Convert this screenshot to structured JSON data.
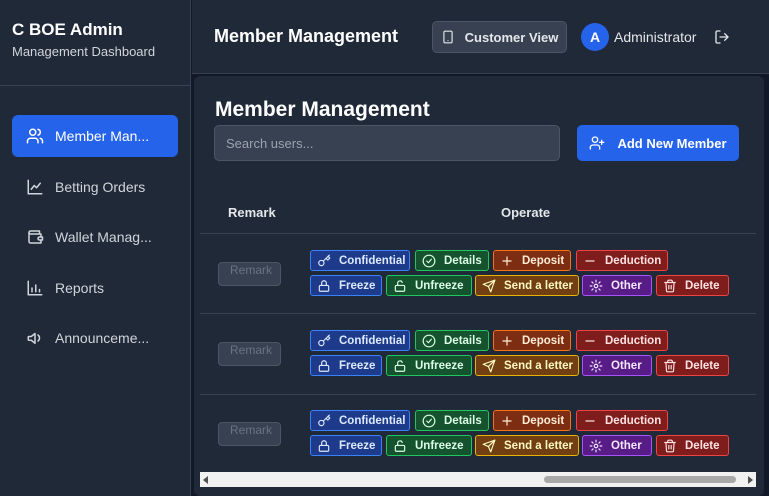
{
  "brand": {
    "title": "C BOE Admin",
    "subtitle": "Management Dashboard"
  },
  "sidebar": {
    "items": [
      {
        "label": "Member Man...",
        "icon": "users-icon",
        "active": true
      },
      {
        "label": "Betting Orders",
        "icon": "chart-line-icon",
        "active": false
      },
      {
        "label": "Wallet Manag...",
        "icon": "wallet-icon",
        "active": false
      },
      {
        "label": "Reports",
        "icon": "bar-chart-icon",
        "active": false
      },
      {
        "label": "Announceme...",
        "icon": "megaphone-icon",
        "active": false
      }
    ]
  },
  "header": {
    "title": "Member Management",
    "customer_view_label": "Customer View",
    "avatar_initial": "A",
    "user_name": "Administrator"
  },
  "main": {
    "title": "Member Management",
    "search_placeholder": "Search users...",
    "add_button_label": "Add New Member",
    "columns": {
      "remark": "Remark",
      "operate": "Operate"
    },
    "remark_placeholder": "Remark",
    "actions": {
      "confidential": "Confidential",
      "details": "Details",
      "deposit": "Deposit",
      "deduction": "Deduction",
      "freeze": "Freeze",
      "unfreeze": "Unfreeze",
      "send_letter": "Send a letter",
      "other": "Other",
      "delete": "Delete"
    }
  },
  "colors": {
    "accent": "#2563eb",
    "background": "#111827",
    "panel": "#1f2937"
  }
}
